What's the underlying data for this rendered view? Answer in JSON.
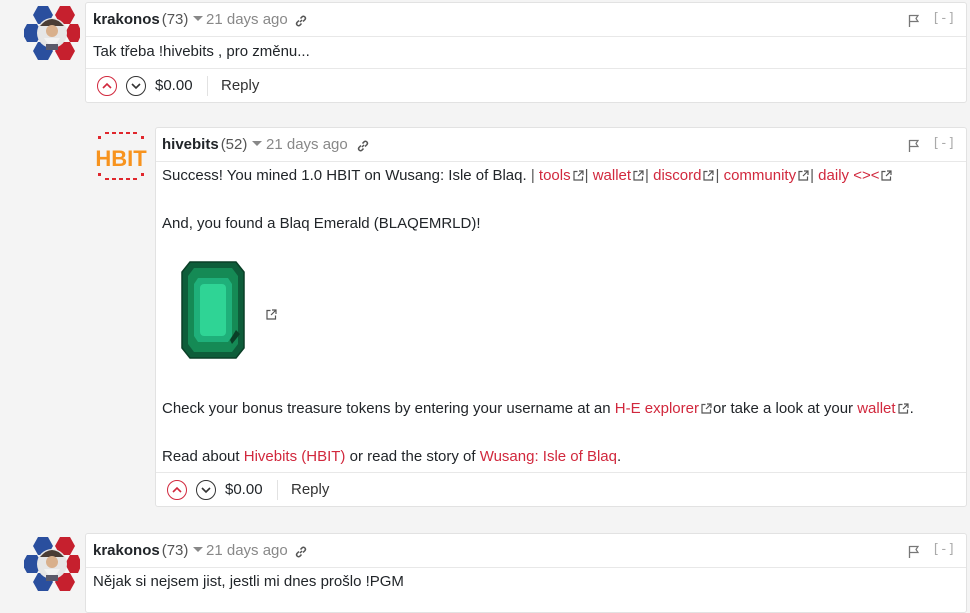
{
  "comments": [
    {
      "author": "krakonos",
      "reputation": "(73)",
      "age": "21 days ago",
      "collapse": "[-]",
      "text": "Tak třeba !hivebits , pro změnu...",
      "payout": "$0.00",
      "reply": "Reply"
    },
    {
      "author": "hivebits",
      "reputation": "(52)",
      "age": "21 days ago",
      "collapse": "[-]",
      "logo_text": "HBIT",
      "line1_prefix": "Success! You mined 1.0 HBIT on Wusang: Isle of Blaq.",
      "links": [
        "tools",
        "wallet",
        "discord",
        "community",
        "daily <><"
      ],
      "line2": "And, you found a Blaq Emerald (BLAQEMRLD)!",
      "line3_prefix": "Check your bonus treasure tokens by entering your username at an",
      "line3_link1": "H-E explorer",
      "line3_mid": "or take a look at your",
      "line3_link2": "wallet",
      "line3_end": ".",
      "line4_prefix": "Read about",
      "line4_link1": "Hivebits (HBIT)",
      "line4_mid": "or read the story of",
      "line4_link2": "Wusang: Isle of Blaq",
      "line4_end": ".",
      "payout": "$0.00",
      "reply": "Reply"
    },
    {
      "author": "krakonos",
      "reputation": "(73)",
      "age": "21 days ago",
      "collapse": "[-]",
      "text": "Nějak si nejsem jist, jestli mi dnes prošlo !PGM"
    }
  ],
  "colors": {
    "accent": "#d1283d",
    "emerald": "#1fb07a",
    "hbit_orange": "#f7931e"
  }
}
